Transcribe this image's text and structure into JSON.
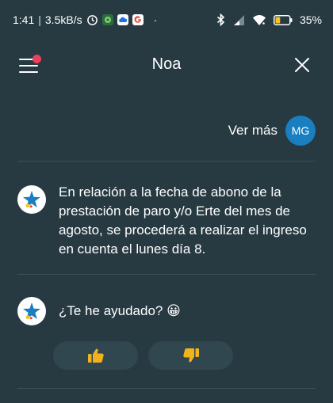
{
  "status_bar": {
    "time": "1:41",
    "speed": "3.5kB/s",
    "battery": "35%",
    "dot": "·"
  },
  "header": {
    "title": "Noa"
  },
  "chat": {
    "user_message": "Ver más",
    "user_initials": "MG",
    "bot_message_1": "En relación a la fecha de abono de la prestación de paro y/o Erte del mes de agosto, se procederá a realizar el ingreso en cuenta el lunes día 8.",
    "bot_message_2": "¿Te he ayudado? 😀"
  },
  "icons": {
    "menu": "hamburger-icon",
    "close": "close-icon",
    "bot_logo": "star-logo",
    "thumbs_up": "thumbs-up-icon",
    "thumbs_down": "thumbs-down-icon"
  },
  "colors": {
    "background": "#273a42",
    "avatar": "#1a7fc0",
    "menu_badge": "#ee3f5e",
    "battery_level": "#f5c518",
    "logo_blue": "#1a7fc0",
    "feedback_button": "#304750"
  },
  "battery_level_fraction": 0.35
}
